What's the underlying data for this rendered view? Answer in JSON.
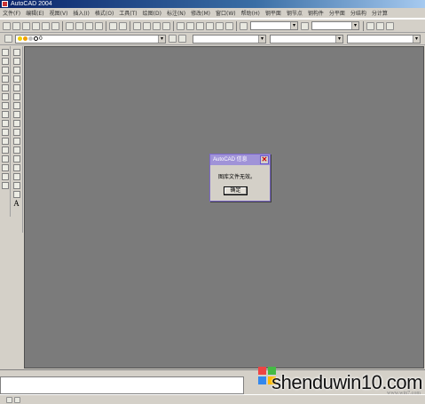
{
  "window": {
    "title": "AutoCAD 2004"
  },
  "menu": {
    "items": [
      "文件(F)",
      "编辑(E)",
      "视图(V)",
      "插入(I)",
      "格式(O)",
      "工具(T)",
      "绘图(D)",
      "标注(N)",
      "修改(M)",
      "窗口(W)",
      "帮助(H)",
      "钢平面",
      "钢节点",
      "钢构件",
      "分平面",
      "分结构",
      "分计算"
    ]
  },
  "layer": {
    "current": "0"
  },
  "dialog": {
    "title": "AutoCAD 信息",
    "message": "图库文件无效。",
    "ok_label": "确定"
  },
  "left_toolbar": {
    "text_tool_label": "A"
  },
  "watermark": {
    "text": "shenduwin10.com",
    "sub": "www.win7.com"
  },
  "colors": {
    "canvas": "#7b7b7b",
    "dialog_border": "#7b68c8",
    "title_gradient_start": "#0a246a"
  }
}
